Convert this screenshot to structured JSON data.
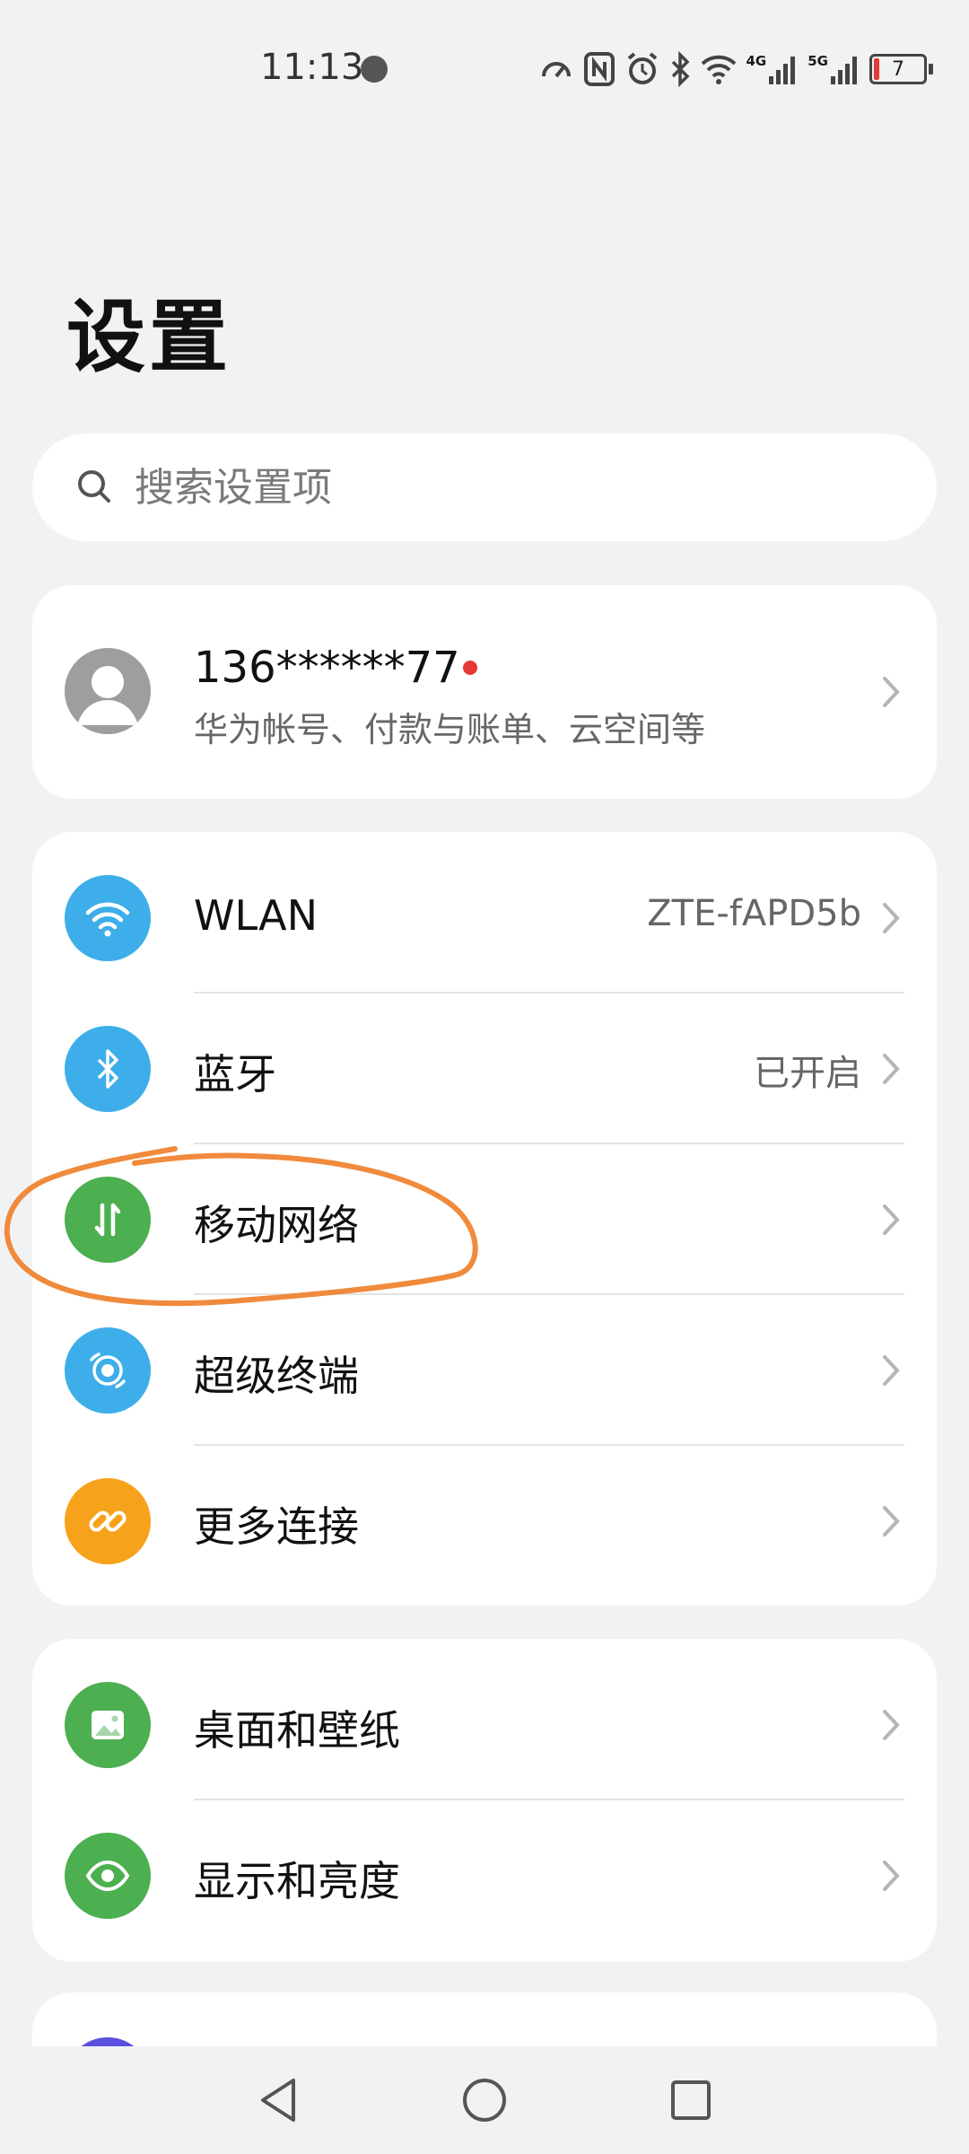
{
  "status_bar": {
    "time": "11:13",
    "network_1": "4G",
    "network_2": "5G",
    "battery": "7"
  },
  "page": {
    "title": "设置"
  },
  "search": {
    "placeholder": "搜索设置项"
  },
  "account": {
    "name": "136******77",
    "subtitle": "华为帐号、付款与账单、云空间等"
  },
  "connections": {
    "items": [
      {
        "label": "WLAN",
        "value": "ZTE-fAPD5b",
        "icon": "wifi-icon",
        "color": "#3daee9"
      },
      {
        "label": "蓝牙",
        "value": "已开启",
        "icon": "bluetooth-icon",
        "color": "#3daee9"
      },
      {
        "label": "移动网络",
        "value": "",
        "icon": "mobile-data-icon",
        "color": "#4caf50"
      },
      {
        "label": "超级终端",
        "value": "",
        "icon": "super-device-icon",
        "color": "#3daee9"
      },
      {
        "label": "更多连接",
        "value": "",
        "icon": "link-icon",
        "color": "#f7a21b"
      }
    ]
  },
  "display": {
    "items": [
      {
        "label": "桌面和壁纸",
        "icon": "wallpaper-icon",
        "color": "#4caf50"
      },
      {
        "label": "显示和亮度",
        "icon": "eye-icon",
        "color": "#4caf50"
      }
    ]
  },
  "colors": {
    "background": "#f1f2f4",
    "annotation": "#f08a3c",
    "notification_dot": "#e53935"
  }
}
